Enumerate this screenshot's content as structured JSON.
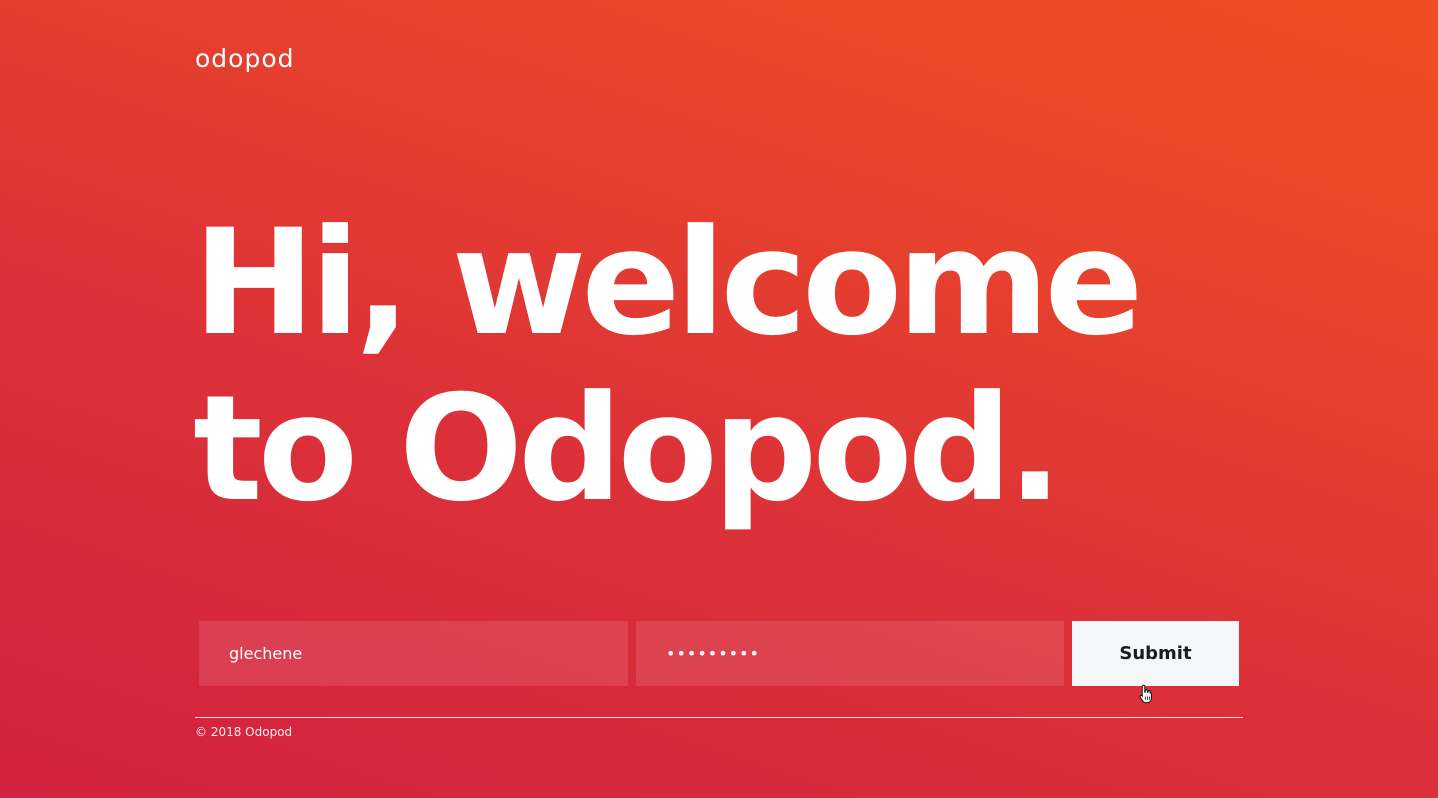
{
  "header": {
    "logo_text": "odopod"
  },
  "hero": {
    "line1": "Hi, welcome",
    "line2": "to Odopod."
  },
  "login_form": {
    "username_value": "glechene",
    "password_value": "•••••••••",
    "submit_label": "Submit"
  },
  "footer": {
    "copyright": "© 2018 Odopod"
  },
  "colors": {
    "background_start": "#d3213f",
    "background_end": "#f04e22",
    "button_bg": "#f5f6f8",
    "button_text": "#1b1b22"
  },
  "icons": {
    "cursor": "hand-pointer-icon"
  }
}
